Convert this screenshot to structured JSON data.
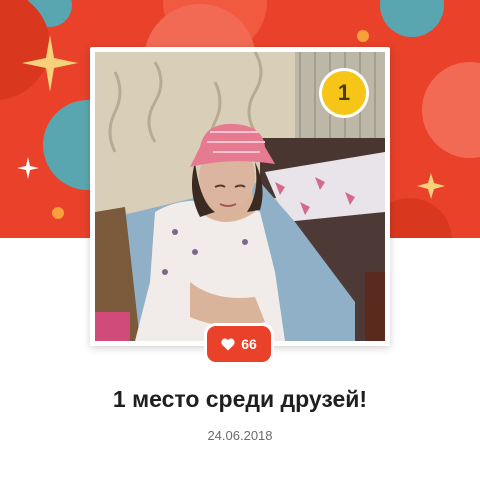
{
  "achievement": {
    "rank": "1",
    "likes_count": "66",
    "title": "1 место среди друзей!",
    "date": "24.06.2018"
  },
  "colors": {
    "banner": "#e9412a",
    "badge": "#f5c518",
    "teal": "#5aa6b0",
    "sparkle": "#f7d27a"
  },
  "icons": [
    "sparkle-icon",
    "heart-icon"
  ]
}
